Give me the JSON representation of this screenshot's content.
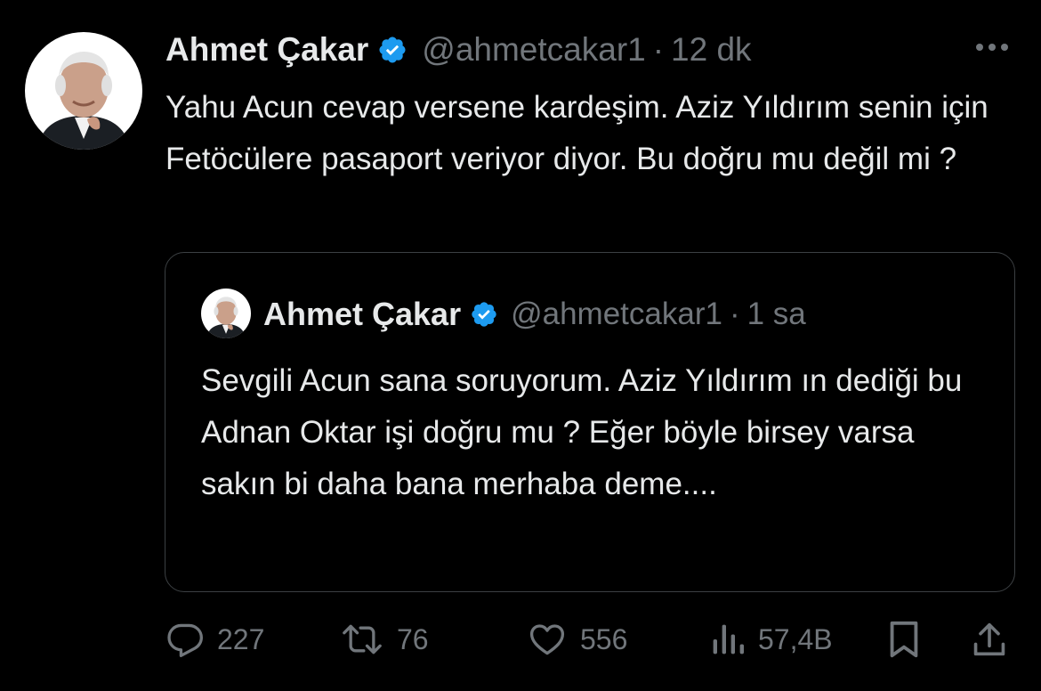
{
  "tweet": {
    "author_name": "Ahmet Çakar",
    "handle": "@ahmetcakar1",
    "separator": "·",
    "time": "12 dk",
    "avatar_icon": "profile-photo",
    "verified_icon": "verified-badge-icon",
    "verified_color": "#1d9bf0",
    "text": "Yahu Acun cevap versene kardeşim. Aziz Yıldırım senin için Fetöcülere pasaport veriyor diyor. Bu doğru mu değil mi ?"
  },
  "quoted_tweet": {
    "author_name": "Ahmet Çakar",
    "handle": "@ahmetcakar1",
    "separator": "·",
    "time": "1 sa",
    "text": "Sevgili Acun sana soruyorum. Aziz Yıldırım ın dediği bu Adnan Oktar işi doğru mu ? Eğer böyle birsey varsa sakın bi daha bana merhaba deme...."
  },
  "actions": {
    "replies": "227",
    "retweets": "76",
    "likes": "556",
    "views": "57,4B"
  },
  "colors": {
    "background": "#000000",
    "text_primary": "#e7e9ea",
    "text_secondary": "#71767b",
    "border": "#3c4043"
  }
}
